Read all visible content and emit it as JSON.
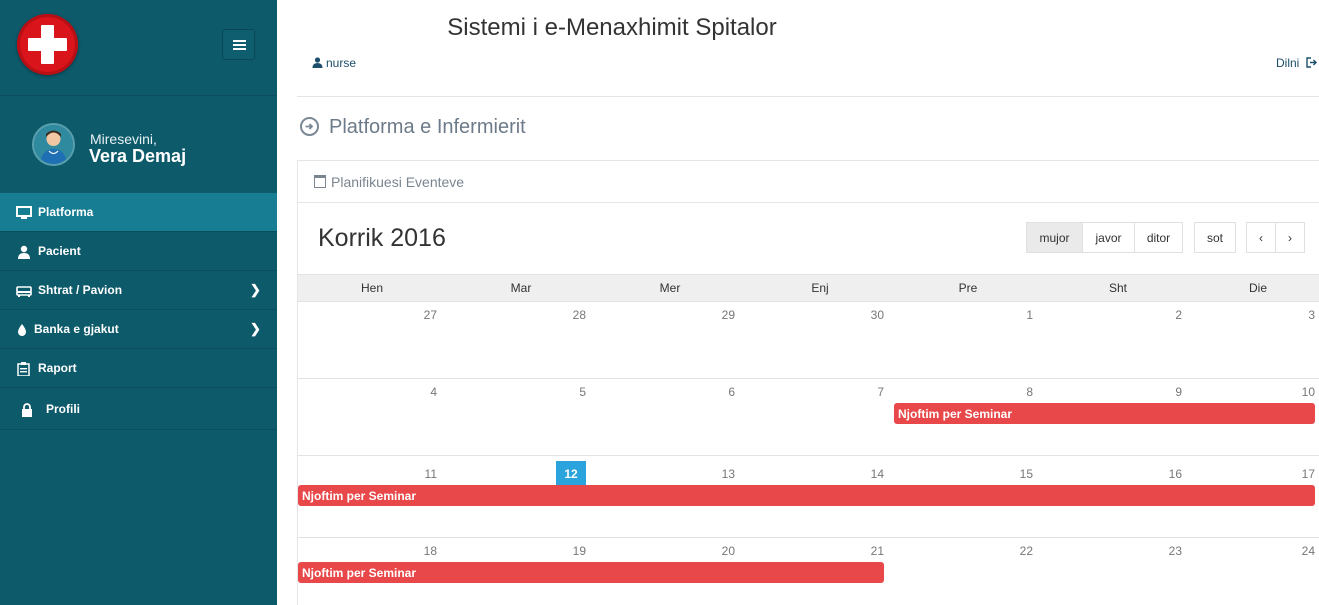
{
  "app": {
    "title": "Sistemi i e-Menaxhimit Spitalor",
    "user": "nurse",
    "logout": "Dilni"
  },
  "sidebar": {
    "welcome": "Miresevini,",
    "name": "Vera Demaj",
    "items": [
      {
        "label": "Platforma",
        "icon": "monitor-icon",
        "active": true
      },
      {
        "label": "Pacient",
        "icon": "user-icon"
      },
      {
        "label": "Shtrat / Pavion",
        "icon": "bed-icon",
        "has_children": true
      },
      {
        "label": "Banka e gjakut",
        "icon": "drop-icon",
        "has_children": true
      },
      {
        "label": "Raport",
        "icon": "clipboard-icon"
      },
      {
        "label": "Profili",
        "icon": "lock-icon"
      }
    ]
  },
  "section": {
    "title": "Platforma e Infermierit"
  },
  "panel": {
    "title": "Planifikuesi Eventeve"
  },
  "calendar": {
    "title": "Korrik 2016",
    "views": [
      "mujor",
      "javor",
      "ditor"
    ],
    "active_view": "mujor",
    "today_label": "sot",
    "prev": "‹",
    "next": "›",
    "weekdays": [
      "Hen",
      "Mar",
      "Mer",
      "Enj",
      "Pre",
      "Sht",
      "Die"
    ],
    "weeks": [
      [
        "27",
        "28",
        "29",
        "30",
        "1",
        "2",
        "3"
      ],
      [
        "4",
        "5",
        "6",
        "7",
        "8",
        "9",
        "10"
      ],
      [
        "11",
        "12",
        "13",
        "14",
        "15",
        "16",
        "17"
      ],
      [
        "18",
        "19",
        "20",
        "21",
        "22",
        "23",
        "24"
      ]
    ],
    "today": "12",
    "events": [
      {
        "title": "Njoftim per Seminar",
        "start": "8",
        "end": "10"
      },
      {
        "title": "Njoftim per Seminar",
        "start": "11",
        "end": "17"
      },
      {
        "title": "Njoftim per Seminar",
        "start": "18",
        "end": "21"
      }
    ],
    "event_color": "#e84849",
    "today_color": "#2ba4dd"
  }
}
